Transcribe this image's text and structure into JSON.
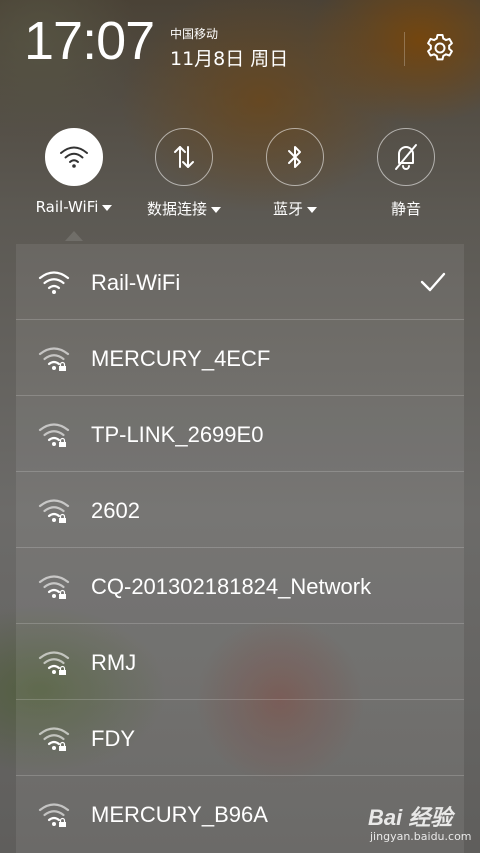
{
  "status": {
    "time": "17:07",
    "carrier": "中国移动",
    "date": "11月8日 周日"
  },
  "icons": {
    "settings": "gear-icon",
    "wifi": "wifi-icon",
    "data": "data-connection-icon",
    "bluetooth": "bluetooth-icon",
    "mute": "bell-mute-icon",
    "selected": "checkmark-icon",
    "secured": "lock-icon"
  },
  "toggles": [
    {
      "label": "Rail-WiFi",
      "active": true,
      "dropdown": true
    },
    {
      "label": "数据连接",
      "active": false,
      "dropdown": true
    },
    {
      "label": "蓝牙",
      "active": false,
      "dropdown": true
    },
    {
      "label": "静音",
      "active": false,
      "dropdown": false
    }
  ],
  "networks": [
    {
      "ssid": "Rail-WiFi",
      "secured": false,
      "connected": true
    },
    {
      "ssid": "MERCURY_4ECF",
      "secured": true,
      "connected": false
    },
    {
      "ssid": "TP-LINK_2699E0",
      "secured": true,
      "connected": false
    },
    {
      "ssid": "2602",
      "secured": true,
      "connected": false
    },
    {
      "ssid": "CQ-201302181824_Network",
      "secured": true,
      "connected": false
    },
    {
      "ssid": "RMJ",
      "secured": true,
      "connected": false
    },
    {
      "ssid": "FDY",
      "secured": true,
      "connected": false
    },
    {
      "ssid": "MERCURY_B96A",
      "secured": true,
      "connected": false
    }
  ],
  "watermark": {
    "brand": "Bai 经验",
    "site": "jingyan.baidu.com"
  }
}
